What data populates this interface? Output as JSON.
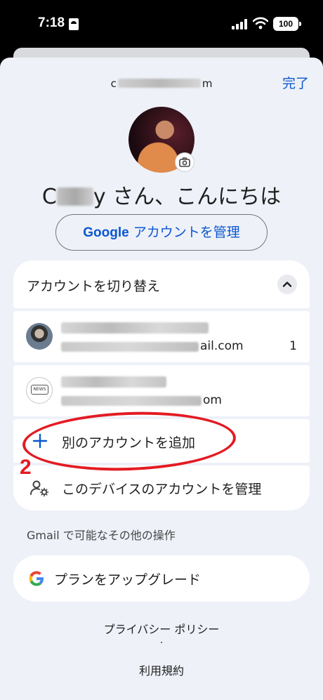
{
  "status_bar": {
    "time": "7:18",
    "battery": "100"
  },
  "header": {
    "email_prefix": "c",
    "email_suffix": "m",
    "done_label": "完了"
  },
  "greeting": {
    "name_start": "C",
    "name_end": "y",
    "text": "さん、こんにちは"
  },
  "manage_account_button": {
    "label_google": "Google",
    "label_rest": "アカウントを管理"
  },
  "account_switcher": {
    "title": "アカウントを切り替え",
    "accounts": [
      {
        "email_suffix": "ail.com",
        "count": "1"
      },
      {
        "email_suffix": "om",
        "avatar_text": "NEWS"
      }
    ]
  },
  "actions": {
    "add_account": "別のアカウントを追加",
    "manage_device_accounts": "このデバイスのアカウントを管理"
  },
  "annotation": {
    "number": "2",
    "color": "#e31b23"
  },
  "gmail_more": "Gmail で可能なその他の操作",
  "upgrade": {
    "label": "プランをアップグレード"
  },
  "footer": {
    "privacy": "プライバシー ポリシー",
    "separator": "·",
    "terms": "利用規約"
  },
  "colors": {
    "accent": "#0b57d0",
    "sheet_bg": "#eef1f8",
    "card_bg": "#ffffff"
  }
}
